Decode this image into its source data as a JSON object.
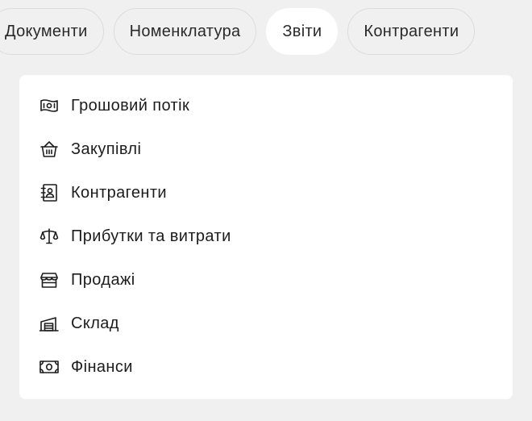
{
  "tabs": [
    {
      "label": "Документи",
      "active": false
    },
    {
      "label": "Номенклатура",
      "active": false
    },
    {
      "label": "Звіти",
      "active": true
    },
    {
      "label": "Контрагенти",
      "active": false
    }
  ],
  "menu": {
    "items": [
      {
        "label": "Грошовий потік",
        "icon": "cash-flow-icon"
      },
      {
        "label": "Закупівлі",
        "icon": "basket-icon"
      },
      {
        "label": "Контрагенти",
        "icon": "contact-book-icon"
      },
      {
        "label": "Прибутки та витрати",
        "icon": "scales-icon"
      },
      {
        "label": "Продажі",
        "icon": "store-icon"
      },
      {
        "label": "Склад",
        "icon": "warehouse-icon"
      },
      {
        "label": "Фінанси",
        "icon": "banknote-icon"
      }
    ]
  },
  "colors": {
    "page_background": "#f0f0f0",
    "panel_background": "#ffffff",
    "active_tab": "#ffffff",
    "text": "#1c1c1c",
    "tab_border": "#dcdcdc"
  }
}
